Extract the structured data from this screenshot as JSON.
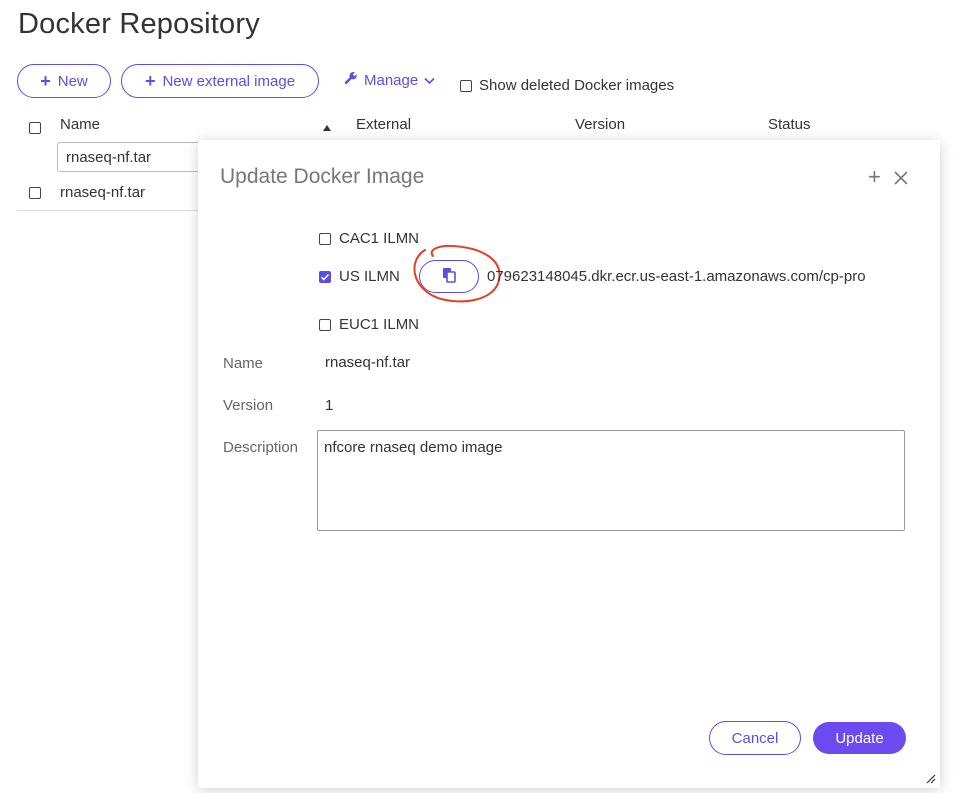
{
  "page": {
    "title": "Docker Repository"
  },
  "toolbar": {
    "new_label": "New",
    "new_external_label": "New external image",
    "manage_label": "Manage",
    "show_deleted_label": "Show deleted Docker images"
  },
  "table": {
    "columns": [
      "Name",
      "External",
      "Version",
      "Status"
    ],
    "sort_column": "Name",
    "name_filter": "rnaseq-nf.tar",
    "rows": [
      {
        "name": "rnaseq-nf.tar"
      }
    ]
  },
  "dialog": {
    "title": "Update Docker Image",
    "regions": [
      {
        "label": "CAC1 ILMN",
        "checked": false
      },
      {
        "label": "US ILMN",
        "checked": true
      },
      {
        "label": "EUC1 ILMN",
        "checked": false
      }
    ],
    "repository_url": "079623148045.dkr.ecr.us-east-1.amazonaws.com/cp-pro",
    "name_label": "Name",
    "name_value": "rnaseq-nf.tar",
    "version_label": "Version",
    "version_value": "1",
    "description_label": "Description",
    "description_value": "nfcore rnaseq demo image",
    "cancel_label": "Cancel",
    "update_label": "Update"
  },
  "colors": {
    "accent": "#5b4ee5",
    "primary_button": "#6b4bef",
    "annotation": "#e0432a"
  }
}
